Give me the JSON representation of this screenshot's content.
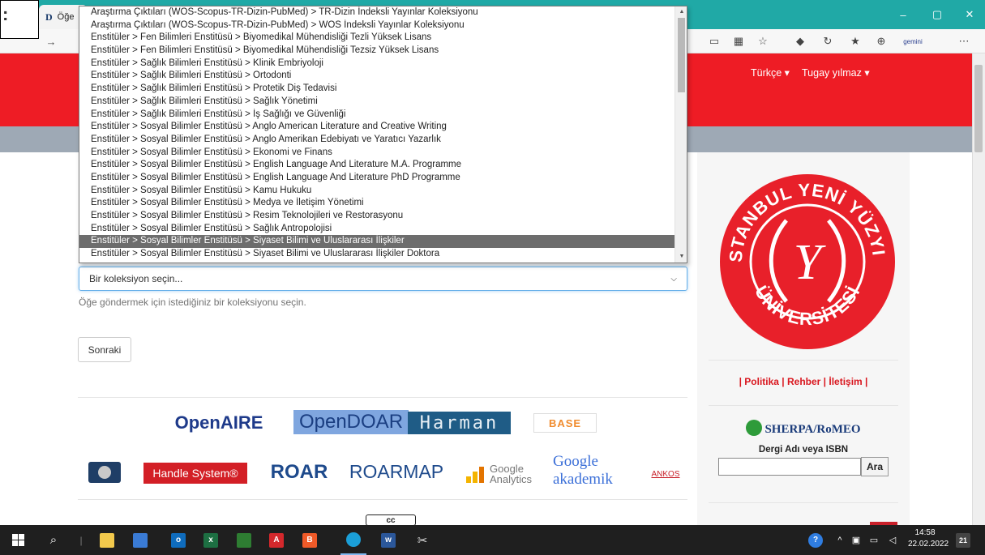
{
  "browser": {
    "tab_title": "Öğe",
    "tab_favicon": "D",
    "window_controls": [
      "–",
      "▢",
      "✕"
    ],
    "toolbar_right_text": "gemini",
    "toolbar_menu": "⋯"
  },
  "callout": {
    "text": ":"
  },
  "header": {
    "language_menu": "Türkçe ▾",
    "user_menu": "Tugay yılmaz ▾"
  },
  "dropdown": {
    "options": [
      "Araştırma Çıktıları (WOS-Scopus-TR-Dizin-PubMed) > TR-Dizin İndeksli Yayınlar Koleksiyonu",
      "Araştırma Çıktıları (WOS-Scopus-TR-Dizin-PubMed) > WOS İndeksli Yayınlar Koleksiyonu",
      "Enstitüler > Fen Bilimleri Enstitüsü > Biyomedikal Mühendisliği Tezli Yüksek Lisans",
      "Enstitüler > Fen Bilimleri Enstitüsü > Biyomedikal Mühendisliği Tezsiz Yüksek Lisans",
      "Enstitüler > Sağlık Bilimleri Enstitüsü > Klinik Embriyoloji",
      "Enstitüler > Sağlık Bilimleri Enstitüsü > Ortodonti",
      "Enstitüler > Sağlık Bilimleri Enstitüsü > Protetik Diş Tedavisi",
      "Enstitüler > Sağlık Bilimleri Enstitüsü > Sağlık Yönetimi",
      "Enstitüler > Sağlık Bilimleri Enstitüsü > İş Sağlığı ve Güvenliği",
      "Enstitüler > Sosyal Bilimler Enstitüsü > Anglo American Literature and Creative Writing",
      "Enstitüler > Sosyal Bilimler Enstitüsü > Anglo Amerikan Edebiyatı ve Yaratıcı Yazarlık",
      "Enstitüler > Sosyal Bilimler Enstitüsü > Ekonomi ve Finans",
      "Enstitüler > Sosyal Bilimler Enstitüsü > English Language And Literature M.A. Programme",
      "Enstitüler > Sosyal Bilimler Enstitüsü > English Language And Literature PhD Programme",
      "Enstitüler > Sosyal Bilimler Enstitüsü > Kamu Hukuku",
      "Enstitüler > Sosyal Bilimler Enstitüsü > Medya ve İletişim Yönetimi",
      "Enstitüler > Sosyal Bilimler Enstitüsü > Resim Teknolojileri ve Restorasyonu",
      "Enstitüler > Sosyal Bilimler Enstitüsü > Sağlık Antropolojisi",
      "Enstitüler > Sosyal Bilimler Enstitüsü > Siyaset Bilimi ve Uluslararası İlişkiler",
      "Enstitüler > Sosyal Bilimler Enstitüsü > Siyaset Bilimi ve Uluslararası İlişkiler Doktora"
    ],
    "selected_index": 18
  },
  "form": {
    "select_value": "Bir koleksiyon seçin...",
    "help_text": "Öğe göndermek için istediğiniz bir koleksiyonu seçin.",
    "next_button": "Sonraki"
  },
  "footer_logos_row1": [
    "OpenAIRE",
    "OpenDOAR",
    "Harman",
    "BASE"
  ],
  "footer_logos_row2": [
    "Handle System®",
    "ROAR",
    "ROARMAP",
    "Google Analytics",
    "Google akademik",
    "ANKOS"
  ],
  "footer_license_badge": "cc",
  "sidebar": {
    "logo_text_top": "İSTANBUL YENİ YÜZYIL",
    "logo_text_bottom": "ÜNİVERSİTESİ",
    "logo_monogram": "Y",
    "links": "| Politika | Rehber | İletişim |",
    "sherpa_title": "SHERPA/RoMEO",
    "issn_label": "Dergi Adı veya ISBN",
    "issn_value": "",
    "search_button": "Ara"
  },
  "taskbar": {
    "time": "14:58",
    "date": "22.02.2022",
    "notifications": "21"
  },
  "colors": {
    "titlebar": "#20a9a6",
    "header_red": "#ee1c25",
    "gray_bar": "#9ea9b5",
    "selected_option": "#6d6d6d"
  }
}
